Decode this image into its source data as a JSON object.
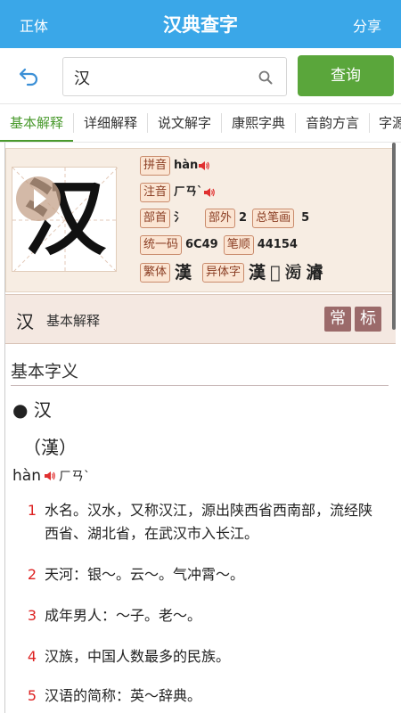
{
  "topbar": {
    "left_label": "正体",
    "title": "汉典查字",
    "right_label": "分享"
  },
  "search": {
    "value": "汉",
    "button_label": "查询"
  },
  "tabs": [
    "基本解释",
    "详细解释",
    "说文解字",
    "康熙字典",
    "音韵方言",
    "字源"
  ],
  "active_tab": "基本解释",
  "char_card": {
    "character": "汉",
    "pinyin_tag": "拼音",
    "pinyin": "hàn",
    "zhuyin_tag": "注音",
    "zhuyin": "ㄏㄢˋ",
    "radical_tag": "部首",
    "radical": "氵",
    "strokes_outside_tag": "部外",
    "strokes_outside": "2",
    "total_strokes_tag": "总笔画",
    "total_strokes": "5",
    "unicode_tag": "统一码",
    "unicode": "6C49",
    "stroke_order_tag": "笔顺",
    "stroke_order": "44154",
    "traditional_tag": "繁体",
    "traditional": "漢",
    "variant_tag": "异体字",
    "variants": [
      "漢",
      "𣴞",
      "𣶢",
      "𤀹"
    ]
  },
  "section_head": {
    "character": "汉",
    "label": "基本解释",
    "badge_common": "常",
    "badge_standard": "标"
  },
  "basic": {
    "title": "基本字义",
    "entry_char": "● 汉",
    "traditional": "（漢）",
    "pinyin": "hàn",
    "zhuyin": "ㄏㄢˋ",
    "definitions": [
      {
        "num": "1",
        "text": "水名。汉水，又称汉江，源出陕西省西南部，流经陕西省、湖北省，在武汉市入长江。"
      },
      {
        "num": "2",
        "text": "天河：银～。云～。气冲霄～。"
      },
      {
        "num": "3",
        "text": "成年男人：～子。老～。"
      },
      {
        "num": "4",
        "text": "汉族，中国人数最多的民族。"
      },
      {
        "num": "5",
        "text": "汉语的简称：英～辞典。"
      }
    ]
  },
  "colors": {
    "topbar": "#3aa7e8",
    "query_button": "#5aa63b",
    "active_tab": "#4a9a2e",
    "def_number": "#dd2222",
    "badge": "#9b6a6a"
  },
  "icons": [
    "back-arrow-icon",
    "search-icon",
    "speaker-icon",
    "play-icon"
  ]
}
